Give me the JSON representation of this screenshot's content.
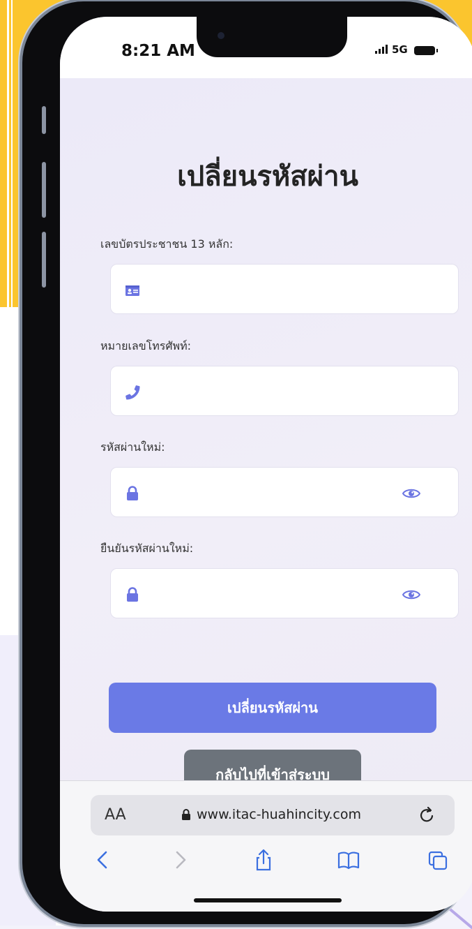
{
  "status_bar": {
    "time": "8:21 AM",
    "network": "5G"
  },
  "page": {
    "title": "เปลี่ยนรหัสผ่าน"
  },
  "form": {
    "id_card": {
      "label": "เลขบัตรประชาชน 13 หลัก:",
      "value": "",
      "icon": "id-card-icon"
    },
    "phone": {
      "label": "หมายเลขโทรศัพท์:",
      "value": "",
      "icon": "phone-icon"
    },
    "new_password": {
      "label": "รหัสผ่านใหม่:",
      "value": "",
      "icon": "lock-icon"
    },
    "confirm_password": {
      "label": "ยืนยันรหัสผ่านใหม่:",
      "value": "",
      "icon": "lock-icon"
    }
  },
  "buttons": {
    "submit_label": "เปลี่ยนรหัสผ่าน",
    "back_label": "กลับไปที่เข้าสู่ระบบ"
  },
  "browser": {
    "text_size": "AA",
    "url": "www.itac-huahincity.com"
  },
  "colors": {
    "accent": "#6a7ae6",
    "secondary": "#6c737b",
    "icon": "#6b74e2",
    "background_yellow": "#fbc52e"
  }
}
